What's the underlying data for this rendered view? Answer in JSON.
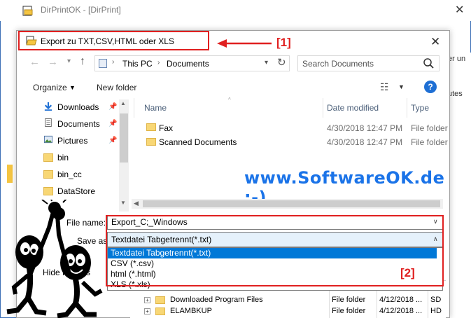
{
  "app": {
    "title": "DirPrintOK - [DirPrint]",
    "right_texts": [
      "er un",
      "utes"
    ]
  },
  "dialog": {
    "title": "Export zu TXT,CSV,HTML oder XLS",
    "annotation_1": "[1]",
    "annotation_2": "[2]"
  },
  "address": {
    "segments": [
      "This PC",
      "Documents"
    ],
    "search_placeholder": "Search Documents"
  },
  "toolbar": {
    "organize": "Organize",
    "new_folder": "New folder"
  },
  "nav_pane": {
    "items": [
      {
        "label": "Downloads",
        "icon": "download-arrow-icon",
        "pinned": true
      },
      {
        "label": "Documents",
        "icon": "document-icon",
        "pinned": true
      },
      {
        "label": "Pictures",
        "icon": "pictures-icon",
        "pinned": true
      },
      {
        "label": "bin",
        "icon": "folder-icon",
        "pinned": false
      },
      {
        "label": "bin_cc",
        "icon": "folder-icon",
        "pinned": false
      },
      {
        "label": "DataStore",
        "icon": "folder-icon",
        "pinned": false
      }
    ]
  },
  "file_list": {
    "columns": [
      "Name",
      "Date modified",
      "Type"
    ],
    "rows": [
      {
        "name": "Fax",
        "date": "4/30/2018 12:47 PM",
        "type": "File folder"
      },
      {
        "name": "Scanned Documents",
        "date": "4/30/2018 12:47 PM",
        "type": "File folder"
      }
    ]
  },
  "watermark": "www.SoftwareOK.de :-)",
  "form": {
    "filename_label": "File name:",
    "filename_value": "Export_C;_Windows",
    "saveas_label": "Save as type:",
    "saveas_value": "Textdatei Tabgetrennt(*.txt)",
    "options": [
      "Textdatei Tabgetrennt(*.txt)",
      "CSV (*.csv)",
      "html (*.html)",
      "XLS (*.xls)"
    ],
    "hide_folders": "Hide Folders"
  },
  "background_list": {
    "rows": [
      {
        "name": "Downloaded Program Files",
        "type": "File folder",
        "date": "4/12/2018 ...",
        "size": "SD"
      },
      {
        "name": "ELAMBKUP",
        "type": "File folder",
        "date": "4/12/2018 ...",
        "size": "HD"
      }
    ]
  },
  "colors": {
    "annotation_red": "#e02020",
    "watermark_blue": "#1a73e8",
    "selection_blue": "#0078d7"
  }
}
